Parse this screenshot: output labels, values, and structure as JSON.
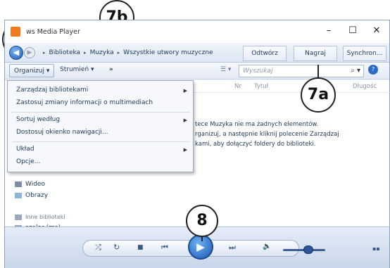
{
  "window": {
    "title": "Windows Media Player",
    "title_visible": "ws Media Player",
    "controls": {
      "minimize": "–",
      "maximize": "☐",
      "close": "✕"
    }
  },
  "nav": {
    "breadcrumb": [
      "Biblioteka",
      "Muzyka",
      "Wszystkie utwory muzyczne"
    ],
    "separator": "▸",
    "tabs": [
      "Odtwórz",
      "Nagraj",
      "Synchron..."
    ]
  },
  "toolbar": {
    "organize": "Organizuj",
    "stream": "Strumień",
    "more": "»",
    "search_placeholder": "Wyszukaj"
  },
  "columns": {
    "no": "Nr",
    "title": "Tytuł",
    "length": "Długość"
  },
  "menu": {
    "items": [
      {
        "label": "Zarządzaj bibliotekami",
        "submenu": true
      },
      {
        "label": "Zastosuj zmiany informacji o multimediach",
        "submenu": false
      },
      {
        "label": "Sortuj według",
        "submenu": true
      },
      {
        "label": "Dostosuj okienko nawigacji...",
        "submenu": false
      },
      {
        "label": "Układ",
        "submenu": true
      },
      {
        "label": "Opcje...",
        "submenu": false
      }
    ]
  },
  "empty_message": [
    "tece Muzyka nie ma żadnych elementów.",
    "rganizuj, a następnie kliknij polecenie Zarządzaj",
    "kami, aby dołączyć foldery do biblioteki."
  ],
  "sidebar": {
    "items": [
      "Wideo",
      "Obrazy",
      "Inne biblioteki",
      "szelor (ms)"
    ]
  },
  "player": {
    "shuffle": "⤮",
    "repeat": "↻",
    "stop": "■",
    "prev": "⏮",
    "play": "▶",
    "next": "⏭",
    "mute": "🔈",
    "switch_view": "▪▪"
  },
  "callouts": [
    "7b",
    "7b",
    "7a",
    "8"
  ],
  "colors": {
    "accent": "#1a58b2",
    "panel": "#dde7f3",
    "callout_border": "#222222"
  }
}
